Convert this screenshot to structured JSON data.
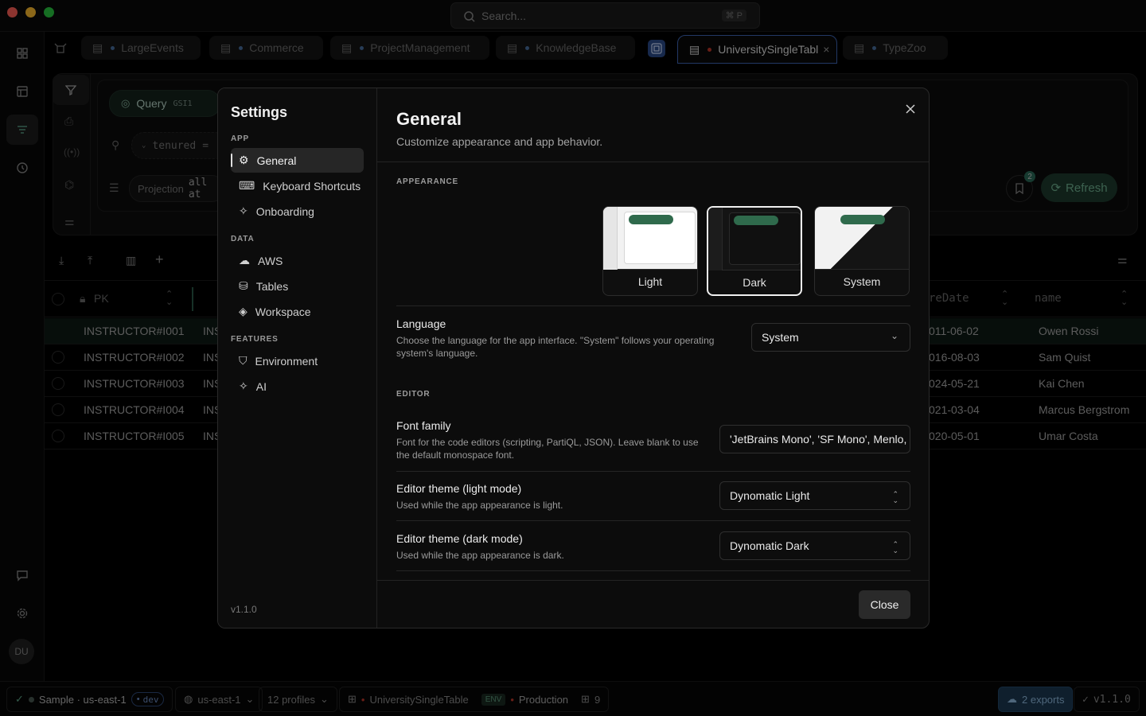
{
  "titlebar": {
    "search_placeholder": "Search...",
    "search_shortcut": "⌘ P",
    "traffic_colors": {
      "close": "#ff5f57",
      "minimize": "#febc2e",
      "zoom": "#28c840"
    }
  },
  "tabs": [
    {
      "label": "LargeEvents"
    },
    {
      "label": "Commerce"
    },
    {
      "label": "ProjectManagement"
    },
    {
      "label": "KnowledgeBase"
    },
    {
      "label": "UniversitySingleTabl",
      "active": true
    },
    {
      "label": "TypeZoo"
    }
  ],
  "query_panel": {
    "mode_label": "Query",
    "index_label": "GSI1",
    "filter_label": "tenured",
    "filter_op": "=",
    "projection_label": "Projection",
    "projection_value": "all at",
    "bookmark_count": "2",
    "refresh_label": "Refresh"
  },
  "table": {
    "columns": {
      "pk": "PK",
      "date": "reDate",
      "name": "name"
    },
    "rows": [
      {
        "pk": "INSTRUCTOR#I001",
        "sk": "INS",
        "date": "011-06-02",
        "name": "Owen Rossi"
      },
      {
        "pk": "INSTRUCTOR#I002",
        "sk": "INS",
        "date": "016-08-03",
        "name": "Sam Quist"
      },
      {
        "pk": "INSTRUCTOR#I003",
        "sk": "INS",
        "date": "024-05-21",
        "name": "Kai Chen"
      },
      {
        "pk": "INSTRUCTOR#I004",
        "sk": "INS",
        "date": "021-03-04",
        "name": "Marcus Bergstrom"
      },
      {
        "pk": "INSTRUCTOR#I005",
        "sk": "INS",
        "date": "020-05-01",
        "name": "Umar Costa"
      }
    ]
  },
  "rail": {
    "avatar_initials": "DU"
  },
  "statusbar": {
    "connection": "Sample · us-east-1",
    "env_chip": "dev",
    "region": "us-east-1",
    "profiles": "12 profiles",
    "table_name": "UniversitySingleTable",
    "env_tag": "ENV",
    "env_name": "Production",
    "count": "9",
    "exports": "2 exports",
    "version": "v1.1.0"
  },
  "settings": {
    "title": "Settings",
    "groups": {
      "app": "APP",
      "data": "DATA",
      "features": "FEATURES"
    },
    "nav": {
      "general": "General",
      "keyboard": "Keyboard Shortcuts",
      "onboarding": "Onboarding",
      "aws": "AWS",
      "tables": "Tables",
      "workspace": "Workspace",
      "environment": "Environment",
      "ai": "AI"
    },
    "version": "v1.1.0",
    "heading": "General",
    "subheading": "Customize appearance and app behavior.",
    "appearance_label": "APPEARANCE",
    "themes": {
      "light": "Light",
      "dark": "Dark",
      "system": "System",
      "selected": "Dark"
    },
    "language": {
      "title": "Language",
      "desc": "Choose the language for the app interface. \"System\" follows your operating system's language.",
      "value": "System"
    },
    "editor_label": "EDITOR",
    "font_family": {
      "title": "Font family",
      "desc": "Font for the code editors (scripting, PartiQL, JSON). Leave blank to use the default monospace font.",
      "value": "'JetBrains Mono', 'SF Mono', Menlo,"
    },
    "editor_light": {
      "title": "Editor theme (light mode)",
      "desc": "Used while the app appearance is light.",
      "value": "Dynomatic Light"
    },
    "editor_dark": {
      "title": "Editor theme (dark mode)",
      "desc": "Used while the app appearance is dark.",
      "value": "Dynomatic Dark"
    },
    "close_label": "Close"
  }
}
